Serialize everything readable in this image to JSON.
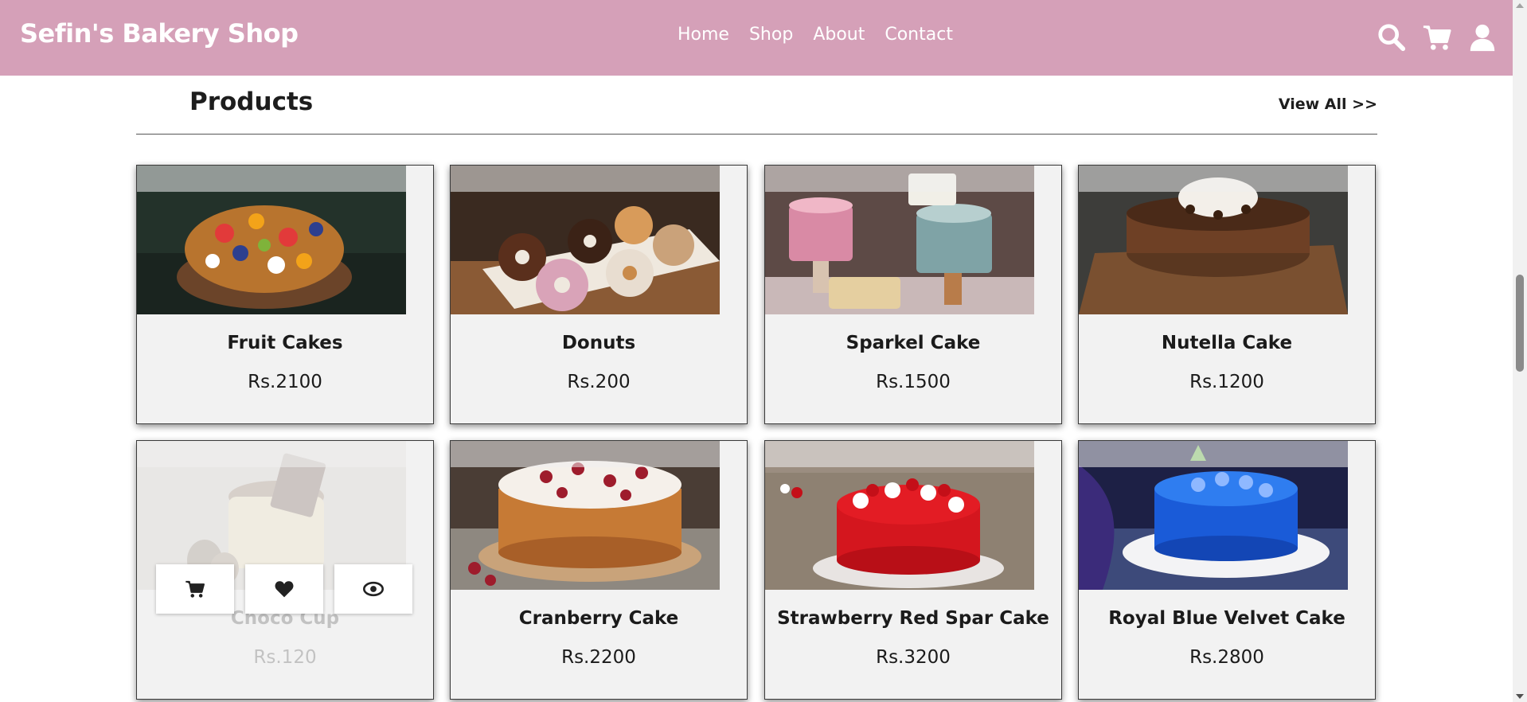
{
  "header": {
    "brand": "Sefin's Bakery Shop",
    "nav": [
      "Home",
      "Shop",
      "About",
      "Contact"
    ],
    "icons": [
      "search-icon",
      "cart-icon",
      "user-icon"
    ],
    "background": "#d5a0b8"
  },
  "section": {
    "title": "Products",
    "view_all": "View All >>"
  },
  "products": [
    {
      "name": "Fruit Cakes",
      "price": "Rs.2100"
    },
    {
      "name": "Donuts",
      "price": "Rs.200"
    },
    {
      "name": "Sparkel Cake",
      "price": "Rs.1500"
    },
    {
      "name": "Nutella Cake",
      "price": "Rs.1200"
    },
    {
      "name": "Choco Cup",
      "price": "Rs.120"
    },
    {
      "name": "Cranberry Cake",
      "price": "Rs.2200"
    },
    {
      "name": "Strawberry Red Spar Cake",
      "price": "Rs.3200"
    },
    {
      "name": "Royal Blue Velvet Cake",
      "price": "Rs.2800"
    }
  ],
  "hover_actions": [
    "cart-icon",
    "heart-icon",
    "eye-icon"
  ]
}
